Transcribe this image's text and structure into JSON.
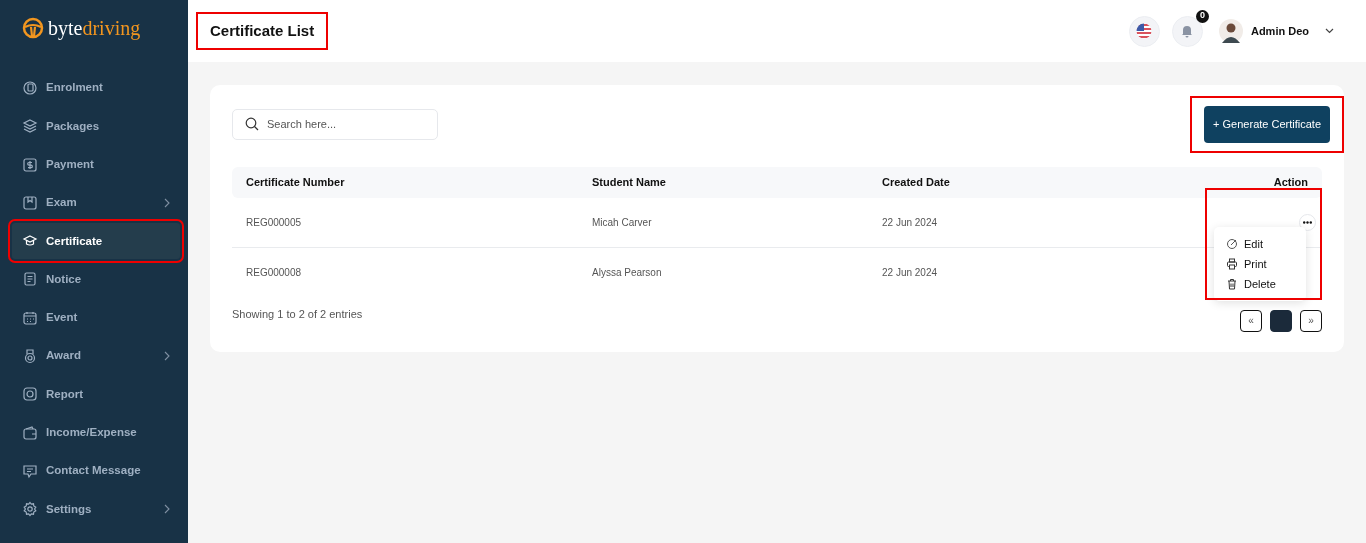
{
  "brand": {
    "part_1": "byte",
    "part_2": "driving"
  },
  "sidebar": {
    "items": [
      {
        "label": "Enrolment",
        "selected": false,
        "expandable": false,
        "highlighted": false
      },
      {
        "label": "Packages",
        "selected": false,
        "expandable": false,
        "highlighted": false
      },
      {
        "label": "Payment",
        "selected": false,
        "expandable": false,
        "highlighted": false
      },
      {
        "label": "Exam",
        "selected": false,
        "expandable": true,
        "highlighted": false
      },
      {
        "label": "Certificate",
        "selected": true,
        "expandable": false,
        "highlighted": true
      },
      {
        "label": "Notice",
        "selected": false,
        "expandable": false,
        "highlighted": false
      },
      {
        "label": "Event",
        "selected": false,
        "expandable": false,
        "highlighted": false
      },
      {
        "label": "Award",
        "selected": false,
        "expandable": true,
        "highlighted": false
      },
      {
        "label": "Report",
        "selected": false,
        "expandable": false,
        "highlighted": false
      },
      {
        "label": "Income/Expense",
        "selected": false,
        "expandable": false,
        "highlighted": false
      },
      {
        "label": "Contact Message",
        "selected": false,
        "expandable": false,
        "highlighted": false
      },
      {
        "label": "Settings",
        "selected": false,
        "expandable": true,
        "highlighted": false
      }
    ]
  },
  "header": {
    "title": "Certificate List",
    "title_highlighted": true,
    "notification_count": "0",
    "user_name": "Admin Deo"
  },
  "search": {
    "placeholder": "Search here..."
  },
  "generate_button": {
    "label": "+ Generate Certificate",
    "highlighted": true
  },
  "table": {
    "columns": [
      "Certificate Number",
      "Student Name",
      "Created Date",
      "Action"
    ],
    "rows": [
      {
        "cells": [
          "REG000005",
          "Micah Carver",
          "22 Jun 2024"
        ]
      },
      {
        "cells": [
          "REG000008",
          "Alyssa Pearson",
          "22 Jun 2024"
        ]
      }
    ]
  },
  "action_menu": {
    "highlighted": true,
    "items": [
      {
        "label": "Edit"
      },
      {
        "label": "Print"
      },
      {
        "label": "Delete"
      }
    ]
  },
  "footer_text": "Showing 1 to 2 of 2 entries",
  "pagination": [
    {
      "label": "«",
      "selected": false
    },
    {
      "selected": true
    },
    {
      "label": "»",
      "selected": false
    }
  ]
}
